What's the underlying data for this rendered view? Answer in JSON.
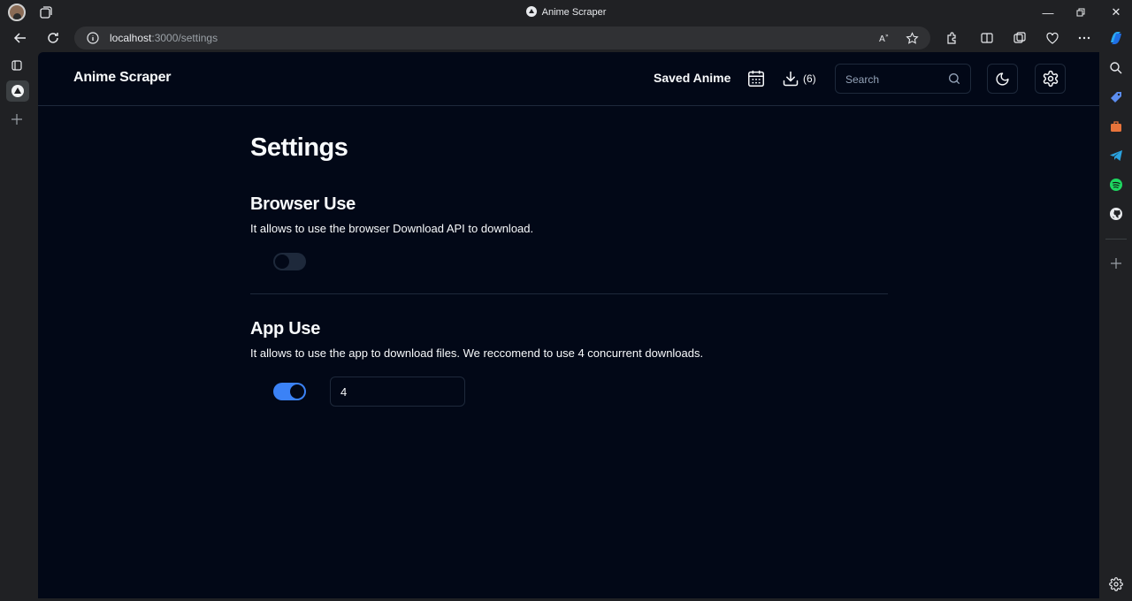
{
  "browser": {
    "tab_title": "Anime Scraper",
    "url_host": "localhost",
    "url_path": ":3000/settings"
  },
  "app": {
    "brand": "Anime Scraper",
    "nav": {
      "saved_anime": "Saved Anime",
      "downloads_count": "(6)",
      "search_placeholder": "Search"
    }
  },
  "settings": {
    "title": "Settings",
    "browser_use": {
      "heading": "Browser Use",
      "description": "It allows to use the browser Download API to download.",
      "enabled": false
    },
    "app_use": {
      "heading": "App Use",
      "description": "It allows to use the app to download files. We reccomend to use 4 concurrent downloads.",
      "enabled": true,
      "concurrent_downloads": "4"
    }
  },
  "colors": {
    "page_bg": "#020817",
    "border": "#1e293b",
    "accent": "#3b82f6",
    "switch_off": "#1e293b"
  }
}
